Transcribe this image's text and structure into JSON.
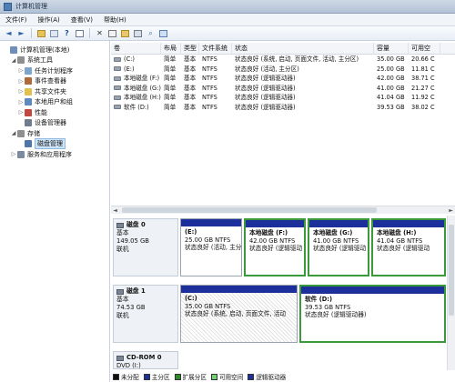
{
  "window": {
    "title": "计算机管理"
  },
  "menu": [
    "文件(F)",
    "操作(A)",
    "查看(V)",
    "帮助(H)"
  ],
  "toolbar": {
    "icons": [
      "back-icon",
      "forward-icon",
      "up-icon",
      "show-tree-icon",
      "help-icon",
      "console-icon",
      "delete-icon",
      "properties-icon",
      "open-icon",
      "rescan-icon",
      "search-icon",
      "details-icon"
    ]
  },
  "tree": [
    {
      "label": "计算机管理(本地)",
      "exp": "",
      "indent": 0,
      "color": "#6d8fb9",
      "icon": "computer-management-icon"
    },
    {
      "label": "系统工具",
      "exp": "◢",
      "indent": 1,
      "color": "#8f8f8f",
      "icon": "system-tools-icon"
    },
    {
      "label": "任务计划程序",
      "exp": "▷",
      "indent": 2,
      "color": "#7ea4d0",
      "icon": "task-scheduler-icon"
    },
    {
      "label": "事件查看器",
      "exp": "▷",
      "indent": 2,
      "color": "#b06a3a",
      "icon": "event-viewer-icon"
    },
    {
      "label": "共享文件夹",
      "exp": "▷",
      "indent": 2,
      "color": "#e2c04d",
      "icon": "shared-folders-icon"
    },
    {
      "label": "本地用户和组",
      "exp": "▷",
      "indent": 2,
      "color": "#5d8ac0",
      "icon": "users-icon"
    },
    {
      "label": "性能",
      "exp": "▷",
      "indent": 2,
      "color": "#c0483e",
      "icon": "performance-icon"
    },
    {
      "label": "设备管理器",
      "exp": "",
      "indent": 2,
      "color": "#6f7d8c",
      "icon": "device-manager-icon"
    },
    {
      "label": "存储",
      "exp": "◢",
      "indent": 1,
      "color": "#8f8f8f",
      "icon": "storage-icon"
    },
    {
      "label": "磁盘管理",
      "exp": "",
      "indent": 2,
      "color": "#4e76a8",
      "icon": "disk-management-icon",
      "selected": true
    },
    {
      "label": "服务和应用程序",
      "exp": "▷",
      "indent": 1,
      "color": "#7a8aa0",
      "icon": "services-icon"
    }
  ],
  "columns": [
    "卷",
    "布局",
    "类型",
    "文件系统",
    "状态",
    "容量",
    "可用空"
  ],
  "volumes": [
    {
      "vol": "(C:)",
      "layout": "简单",
      "type": "基本",
      "fs": "NTFS",
      "status": "状态良好 (系统, 启动, 页面文件, 活动, 主分区)",
      "cap": "35.00 GB",
      "free": "20.66 C"
    },
    {
      "vol": "(E:)",
      "layout": "简单",
      "type": "基本",
      "fs": "NTFS",
      "status": "状态良好 (活动, 主分区)",
      "cap": "25.00 GB",
      "free": "11.81 C"
    },
    {
      "vol": "本地磁盘 (F:)",
      "layout": "简单",
      "type": "基本",
      "fs": "NTFS",
      "status": "状态良好 (逻辑驱动器)",
      "cap": "42.00 GB",
      "free": "38.71 C"
    },
    {
      "vol": "本地磁盘 (G:)",
      "layout": "简单",
      "type": "基本",
      "fs": "NTFS",
      "status": "状态良好 (逻辑驱动器)",
      "cap": "41.00 GB",
      "free": "21.27 C"
    },
    {
      "vol": "本地磁盘 (H:)",
      "layout": "简单",
      "type": "基本",
      "fs": "NTFS",
      "status": "状态良好 (逻辑驱动器)",
      "cap": "41.04 GB",
      "free": "11.92 C"
    },
    {
      "vol": "软件 (D:)",
      "layout": "简单",
      "type": "基本",
      "fs": "NTFS",
      "status": "状态良好 (逻辑驱动器)",
      "cap": "39.53 GB",
      "free": "38.02 C"
    }
  ],
  "disks": [
    {
      "name": "磁盘 0",
      "kind": "基本",
      "size": "149.05 GB",
      "state": "联机",
      "parts": [
        {
          "title": "(E:)",
          "size": "25.00 GB NTFS",
          "status": "状态良好 (活动, 主分区)",
          "bar": "#1d2f9b",
          "sel": false,
          "hatch": false
        },
        {
          "title": "本地磁盘 (F:)",
          "size": "42.00 GB NTFS",
          "status": "状态良好 (逻辑驱动",
          "bar": "#1d2f9b",
          "sel": true,
          "hatch": false
        },
        {
          "title": "本地磁盘 (G:)",
          "size": "41.00 GB NTFS",
          "status": "状态良好 (逻辑驱动",
          "bar": "#1d2f9b",
          "sel": true,
          "hatch": false
        },
        {
          "title": "本地磁盘 (H:)",
          "size": "41.04 GB NTFS",
          "status": "状态良好 (逻辑驱动",
          "bar": "#1d2f9b",
          "sel": true,
          "hatch": false
        }
      ]
    },
    {
      "name": "磁盘 1",
      "kind": "基本",
      "size": "74.53 GB",
      "state": "联机",
      "parts": [
        {
          "title": "(C:)",
          "size": "35.00 GB NTFS",
          "status": "状态良好 (系统, 启动, 页面文件, 活动",
          "bar": "#1d2f9b",
          "sel": false,
          "hatch": true
        },
        {
          "title": "软件 (D:)",
          "size": "39.53 GB NTFS",
          "status": "状态良好 (逻辑驱动器)",
          "bar": "#1d2f9b",
          "sel": true,
          "hatch": false
        }
      ]
    },
    {
      "name": "CD-ROM 0",
      "kind": "DVD (I:)",
      "size": "",
      "state": "",
      "parts": []
    }
  ],
  "legend": [
    {
      "label": "未分配",
      "color": "#111111"
    },
    {
      "label": "主分区",
      "color": "#1d2f9b"
    },
    {
      "label": "扩展分区",
      "color": "#2e8b2e"
    },
    {
      "label": "可用空间",
      "color": "#6fd16f"
    },
    {
      "label": "逻辑驱动器",
      "color": "#1d2f9b"
    }
  ]
}
